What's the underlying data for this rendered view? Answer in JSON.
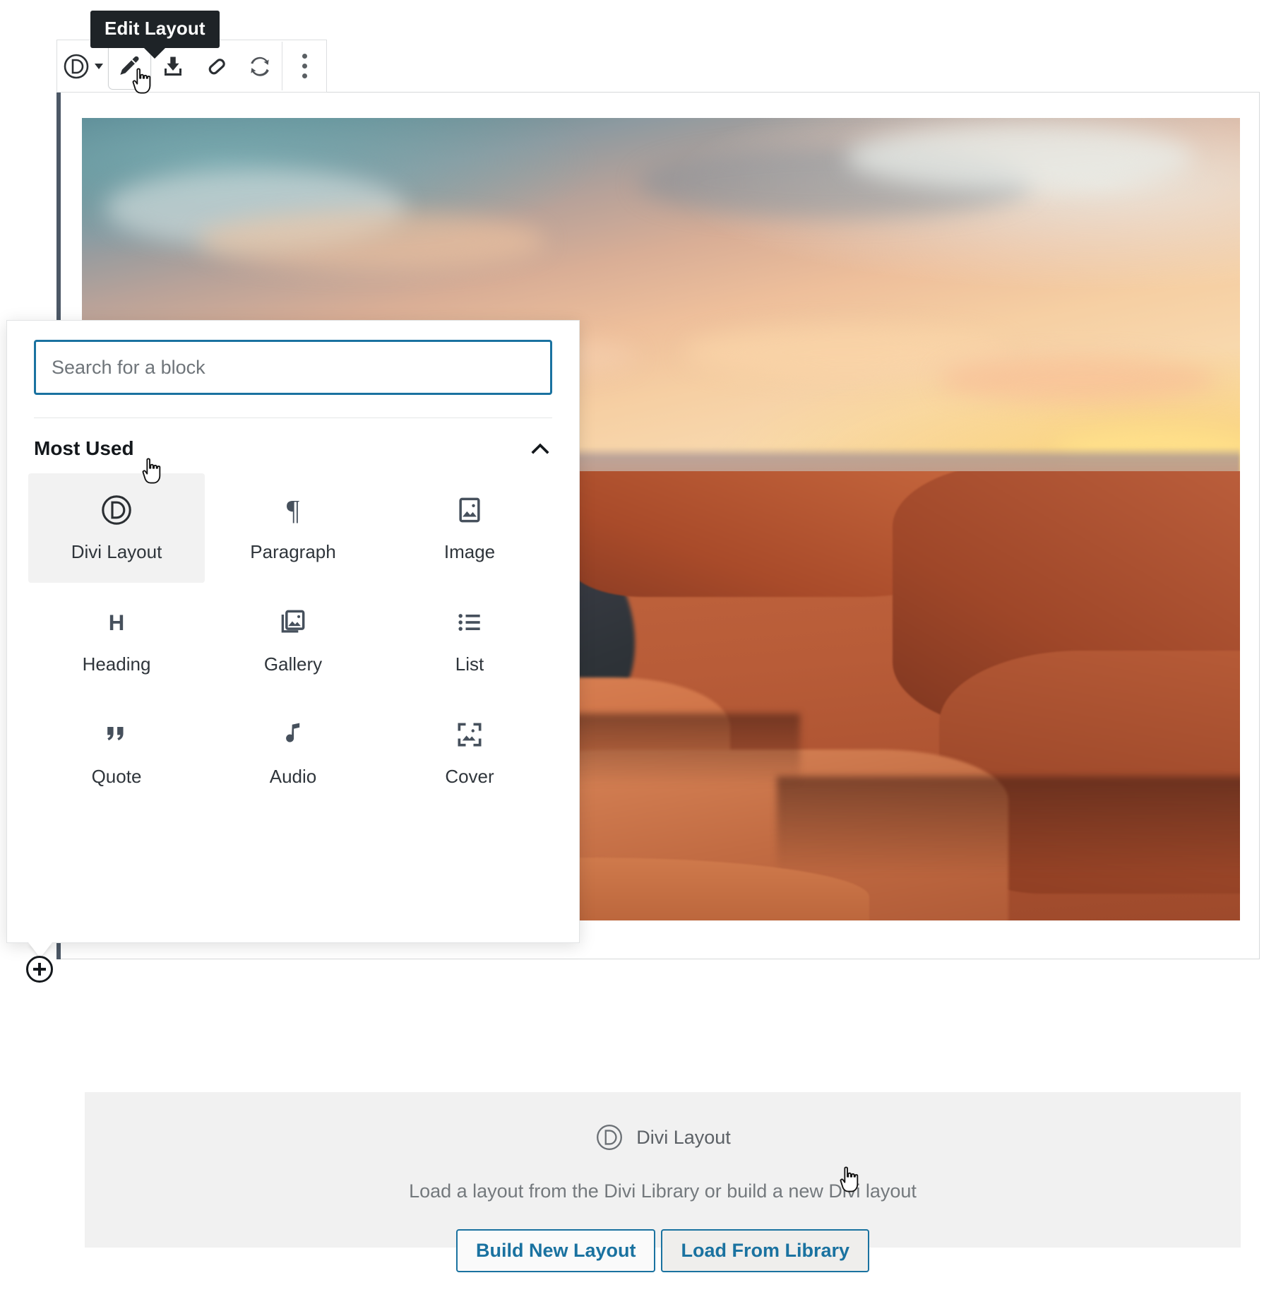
{
  "tooltip": {
    "text": "Edit Layout"
  },
  "toolbar": {
    "items": [
      {
        "name": "divi-block-type-button",
        "icon": "divi-logo-icon",
        "label": "Divi"
      },
      {
        "name": "edit-layout-button",
        "icon": "pencil-icon",
        "label": "Edit Layout"
      },
      {
        "name": "save-to-library-button",
        "icon": "download-icon",
        "label": "Save to Library"
      },
      {
        "name": "clear-layout-button",
        "icon": "eraser-icon",
        "label": "Clear Layout"
      },
      {
        "name": "sync-button",
        "icon": "sync-icon",
        "label": "Sync"
      },
      {
        "name": "more-options-button",
        "icon": "three-dots-vertical-icon",
        "label": "More options"
      }
    ]
  },
  "inserter": {
    "search": {
      "placeholder": "Search for a block",
      "value": ""
    },
    "section": {
      "title": "Most Used",
      "collapse_icon": "chevron-up-icon",
      "expanded": true
    },
    "blocks": [
      {
        "label": "Divi Layout",
        "icon": "divi-logo-icon",
        "active": true
      },
      {
        "label": "Paragraph",
        "icon": "pilcrow-icon",
        "active": false
      },
      {
        "label": "Image",
        "icon": "image-icon",
        "active": false
      },
      {
        "label": "Heading",
        "icon": "heading-h-icon",
        "active": false
      },
      {
        "label": "Gallery",
        "icon": "gallery-icon",
        "active": false
      },
      {
        "label": "List",
        "icon": "list-icon",
        "active": false
      },
      {
        "label": "Quote",
        "icon": "quote-icon",
        "active": false
      },
      {
        "label": "Audio",
        "icon": "music-note-icon",
        "active": false
      },
      {
        "label": "Cover",
        "icon": "cover-image-icon",
        "active": false
      }
    ]
  },
  "add_block_button": {
    "icon": "plus-circle-icon",
    "label": "Add block"
  },
  "divi_placeholder": {
    "icon": "divi-logo-icon",
    "title": "Divi Layout",
    "description": "Load a layout from the Divi Library or build a new Divi layout",
    "primary_button": "Build New Layout",
    "secondary_button": "Load From Library"
  },
  "colors": {
    "accent_blue": "#1a72a0",
    "tooltip_bg": "#1e2327",
    "placeholder_bg": "#f1f1f1",
    "block_indicator": "#4c5866",
    "icon_slate": "#46505c"
  }
}
